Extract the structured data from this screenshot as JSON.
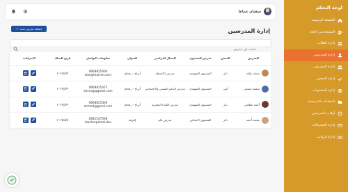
{
  "sidebar": {
    "title": "لوحة التحكم",
    "items": [
      {
        "label": "الصفحة الرئيسية",
        "icon": "home-icon"
      },
      {
        "label": "المستخدمين الجدد",
        "icon": "user-plus-icon"
      },
      {
        "label": "إدارة الطلاب",
        "icon": "users-icon"
      },
      {
        "label": "إدارة المدرسين",
        "icon": "teacher-icon",
        "active": true
      },
      {
        "label": "إدارة المشرفين",
        "icon": "users-icon"
      },
      {
        "label": "إدارة الحضور",
        "icon": "check-icon"
      },
      {
        "label": "إدارة المستويات",
        "icon": "layers-icon"
      },
      {
        "label": "المجلدات التدريسية",
        "icon": "folder-icon"
      },
      {
        "label": "أوقات المدرسين",
        "icon": "clock-icon"
      },
      {
        "label": "إدارة الاشتراكات",
        "icon": "card-icon"
      },
      {
        "label": "إدارة الرواتب",
        "icon": "money-icon"
      }
    ]
  },
  "topbar": {
    "user_name": "سفيان عماعا"
  },
  "page": {
    "title": "إدارة المدرسين",
    "add_label": "إضافة مدرس جديد"
  },
  "search": {
    "placeholder": "ابحث عن مدرس..."
  },
  "table": {
    "headers": [
      "المدرس",
      "الجنس",
      "مدرس المستوى",
      "المجال الدراسي",
      "العنوان",
      "معلومات التواصل",
      "تاريخ الميلاد",
      "الإجراءات"
    ],
    "rows": [
      {
        "name": "مختار عقاه",
        "gender": "ذكر",
        "level": "المستوى التمهيدي",
        "field": "مدرس الأنشطة",
        "address": "أبراج - رفحان",
        "phone": "0668825400",
        "email": "test@teacher.com",
        "dob": "٢٠٢٤/٥/٣",
        "pic": "#b98a5e"
      },
      {
        "name": "سمعة سمعي",
        "gender": "أنثى",
        "level": "المستوى التمهيدي",
        "field": "مدرس الدعم النفسي والاجتماعي",
        "address": "أبراج - رفحان",
        "phone": "0668825473",
        "email": "kavvag@gmail.com",
        "dob": "٢٠٢٤/٥/٣",
        "pic": "#4a6fa0"
      },
      {
        "name": "أحمد عطاس",
        "gender": "ذكر",
        "level": "المستوى التمهيدي",
        "field": "مدرس اللغة الانجليزية",
        "address": "أبراج - رفحان",
        "phone": "0668825400",
        "email": "ahmed@gmail.com",
        "dob": "٢٠٢٤/٥/٩",
        "pic": "#6b3b2a"
      },
      {
        "name": "محمد أحمد",
        "gender": "ذكر",
        "level": "المستوى الابتدائي",
        "field": "مدرس عام",
        "address": "إلبرقة",
        "phone": "0681547568",
        "email": "teacherpatest.dev",
        "dob": "٢٠٢٤/٥/٥",
        "pic": "#c9a27a"
      }
    ]
  },
  "colors": {
    "sidebar": "#d69a2a",
    "active": "#e8722e",
    "primary": "#1f4f9c"
  }
}
